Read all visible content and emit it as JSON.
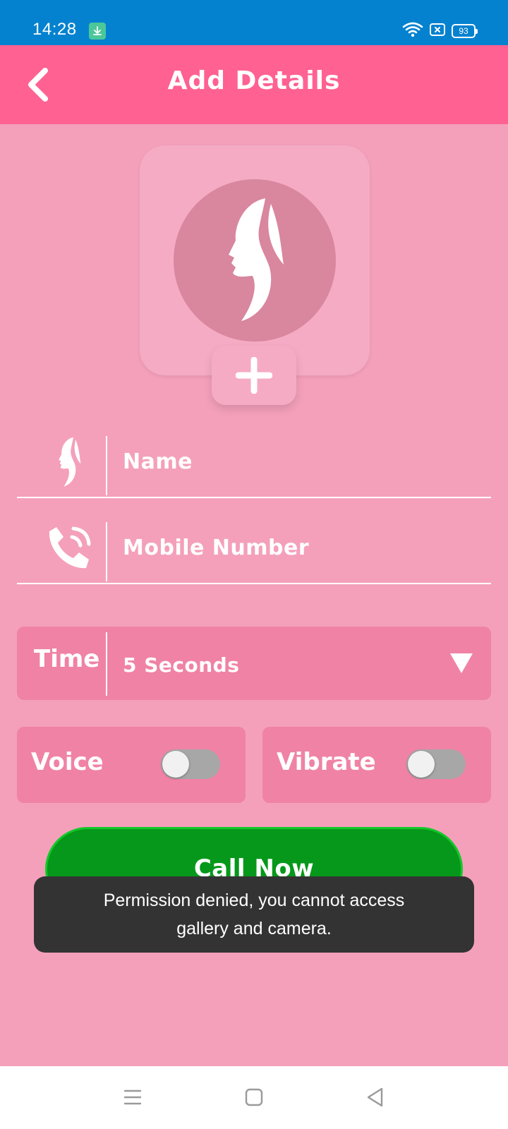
{
  "status_bar": {
    "time": "14:28",
    "battery": "93",
    "download_icon": "download-badge-icon",
    "wifi_icon": "wifi-icon",
    "sim_icon": "no-sim-icon"
  },
  "app_bar": {
    "title": "Add Details",
    "back_icon": "chevron-left-icon",
    "color": "#ff6192"
  },
  "profile_photo": {
    "icon": "woman-silhouette-icon",
    "add_icon": "plus-icon"
  },
  "form": {
    "name": {
      "placeholder": "Name",
      "value": "",
      "icon": "woman-silhouette-icon"
    },
    "mobile": {
      "placeholder": "Mobile Number",
      "value": "",
      "icon": "phone-ringing-icon"
    }
  },
  "time": {
    "label": "Time",
    "value": "5 Seconds",
    "dropdown_icon": "triangle-down-icon"
  },
  "toggles": {
    "voice": {
      "label": "Voice",
      "on": false
    },
    "vibrate": {
      "label": "Vibrate",
      "on": false
    }
  },
  "call_button": {
    "label": "Call Now",
    "color": "#06981a"
  },
  "toast": {
    "line1": "Permission denied, you cannot access",
    "line2": "gallery and camera."
  },
  "nav_bar": {
    "menu_icon": "menu-icon",
    "home_icon": "square-home-icon",
    "back_icon": "triangle-back-icon"
  },
  "colors": {
    "background": "#f4a0bb",
    "status_bar": "#0582cf",
    "card": "#f082a6",
    "toast": "#333333"
  }
}
